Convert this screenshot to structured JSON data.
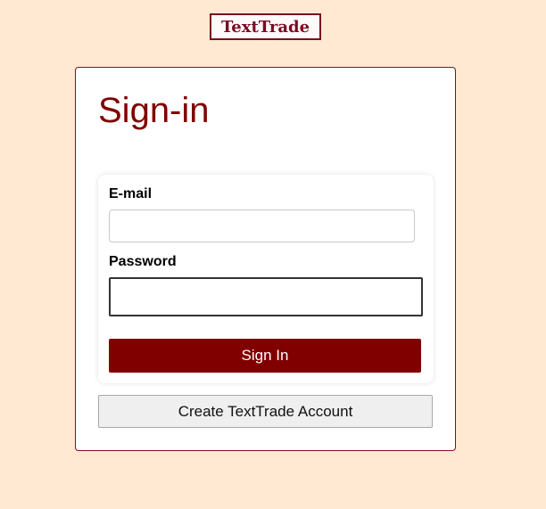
{
  "logo": {
    "text": "TextTrade"
  },
  "page": {
    "title": "Sign-in"
  },
  "form": {
    "email_label": "E-mail",
    "email_value": "",
    "password_label": "Password",
    "password_value": "",
    "signin_label": "Sign In"
  },
  "create_account": {
    "label": "Create TextTrade Account"
  },
  "colors": {
    "background": "#ffe9d3",
    "accent": "#800000",
    "logo_border": "#7a0a22",
    "secondary_button": "#efefef"
  }
}
